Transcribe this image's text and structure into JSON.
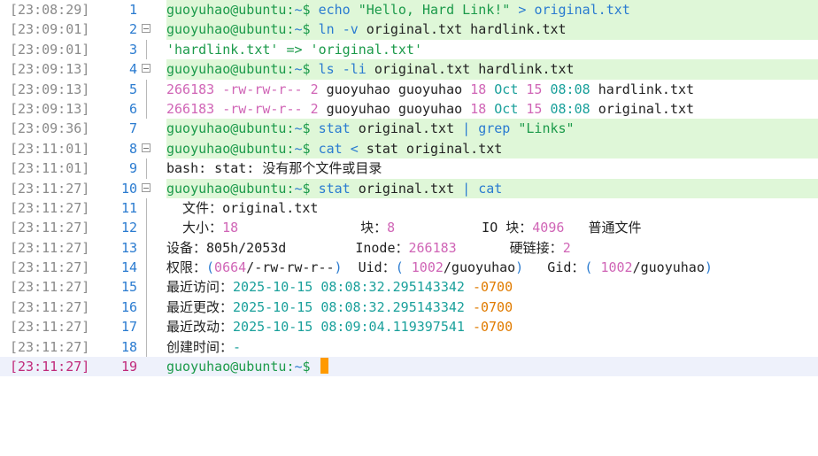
{
  "lines": [
    {
      "ts": "[23:08:29]",
      "n": "1",
      "user": "guoyuhao@ubuntu",
      "path": "~",
      "cmd": "echo",
      "a1": "\"Hello, Hard Link!\"",
      "op": ">",
      "a2": "original.txt"
    },
    {
      "ts": "[23:09:01]",
      "n": "2",
      "user": "guoyuhao@ubuntu",
      "path": "~",
      "cmd": "ln",
      "flag": "-v",
      "a1": "original.txt hardlink.txt"
    },
    {
      "ts": "[23:09:01]",
      "n": "3",
      "text": "'hardlink.txt' => 'original.txt'"
    },
    {
      "ts": "[23:09:13]",
      "n": "4",
      "user": "guoyuhao@ubuntu",
      "path": "~",
      "cmd": "ls",
      "flag": "-li",
      "a1": "original.txt hardlink.txt"
    },
    {
      "ts": "[23:09:13]",
      "n": "5",
      "inode": "266183",
      "perm": "-rw-rw-r--",
      "links": "2",
      "owner": "guoyuhao guoyuhao",
      "size": "18",
      "month": "Oct",
      "day": "15",
      "time": "08:08",
      "file": "hardlink.txt"
    },
    {
      "ts": "[23:09:13]",
      "n": "6",
      "inode": "266183",
      "perm": "-rw-rw-r--",
      "links": "2",
      "owner": "guoyuhao guoyuhao",
      "size": "18",
      "month": "Oct",
      "day": "15",
      "time": "08:08",
      "file": "original.txt"
    },
    {
      "ts": "[23:09:36]",
      "n": "7",
      "user": "guoyuhao@ubuntu",
      "path": "~",
      "cmd": "stat",
      "a1": "original.txt",
      "op": "|",
      "cmd2": "grep",
      "a2": "\"Links\""
    },
    {
      "ts": "[23:11:01]",
      "n": "8",
      "user": "guoyuhao@ubuntu",
      "path": "~",
      "cmd": "cat",
      "op": "<",
      "a1": "stat original.txt"
    },
    {
      "ts": "[23:11:01]",
      "n": "9",
      "text": "bash: stat: 没有那个文件或目录"
    },
    {
      "ts": "[23:11:27]",
      "n": "10",
      "user": "guoyuhao@ubuntu",
      "path": "~",
      "cmd": "stat",
      "a1": "original.txt",
      "op": "|",
      "cmd2": "cat"
    },
    {
      "ts": "[23:11:27]",
      "n": "11",
      "label": "  文件：",
      "value": "original.txt"
    },
    {
      "ts": "[23:11:27]",
      "n": "12",
      "l1": "  大小：",
      "v1": "18",
      "l2": "块：",
      "v2": "8",
      "l3": "IO 块：",
      "v3": "4096",
      "v4": "普通文件"
    },
    {
      "ts": "[23:11:27]",
      "n": "13",
      "l1": "设备：",
      "v1": "805h/2053d",
      "l2": "Inode：",
      "v2": "266183",
      "l3": "硬链接：",
      "v3": "2"
    },
    {
      "ts": "[23:11:27]",
      "n": "14",
      "l1": "权限：",
      "p1": "0664",
      "p2": "/-rw-rw-r--",
      "l2": "Uid：",
      "u1": "1002",
      "u2": "/guoyuhao",
      "l3": "Gid：",
      "g1": "1002",
      "g2": "/guoyuhao"
    },
    {
      "ts": "[23:11:27]",
      "n": "15",
      "label": "最近访问：",
      "date": "2025-10-15",
      "time": "08:08:32.295143342",
      "tz": "-0700"
    },
    {
      "ts": "[23:11:27]",
      "n": "16",
      "label": "最近更改：",
      "date": "2025-10-15",
      "time": "08:08:32.295143342",
      "tz": "-0700"
    },
    {
      "ts": "[23:11:27]",
      "n": "17",
      "label": "最近改动：",
      "date": "2025-10-15",
      "time": "08:09:04.119397541",
      "tz": "-0700"
    },
    {
      "ts": "[23:11:27]",
      "n": "18",
      "label": "创建时间：",
      "value": "-"
    },
    {
      "ts": "[23:11:27]",
      "n": "19",
      "user": "guoyuhao@ubuntu",
      "path": "~"
    }
  ]
}
